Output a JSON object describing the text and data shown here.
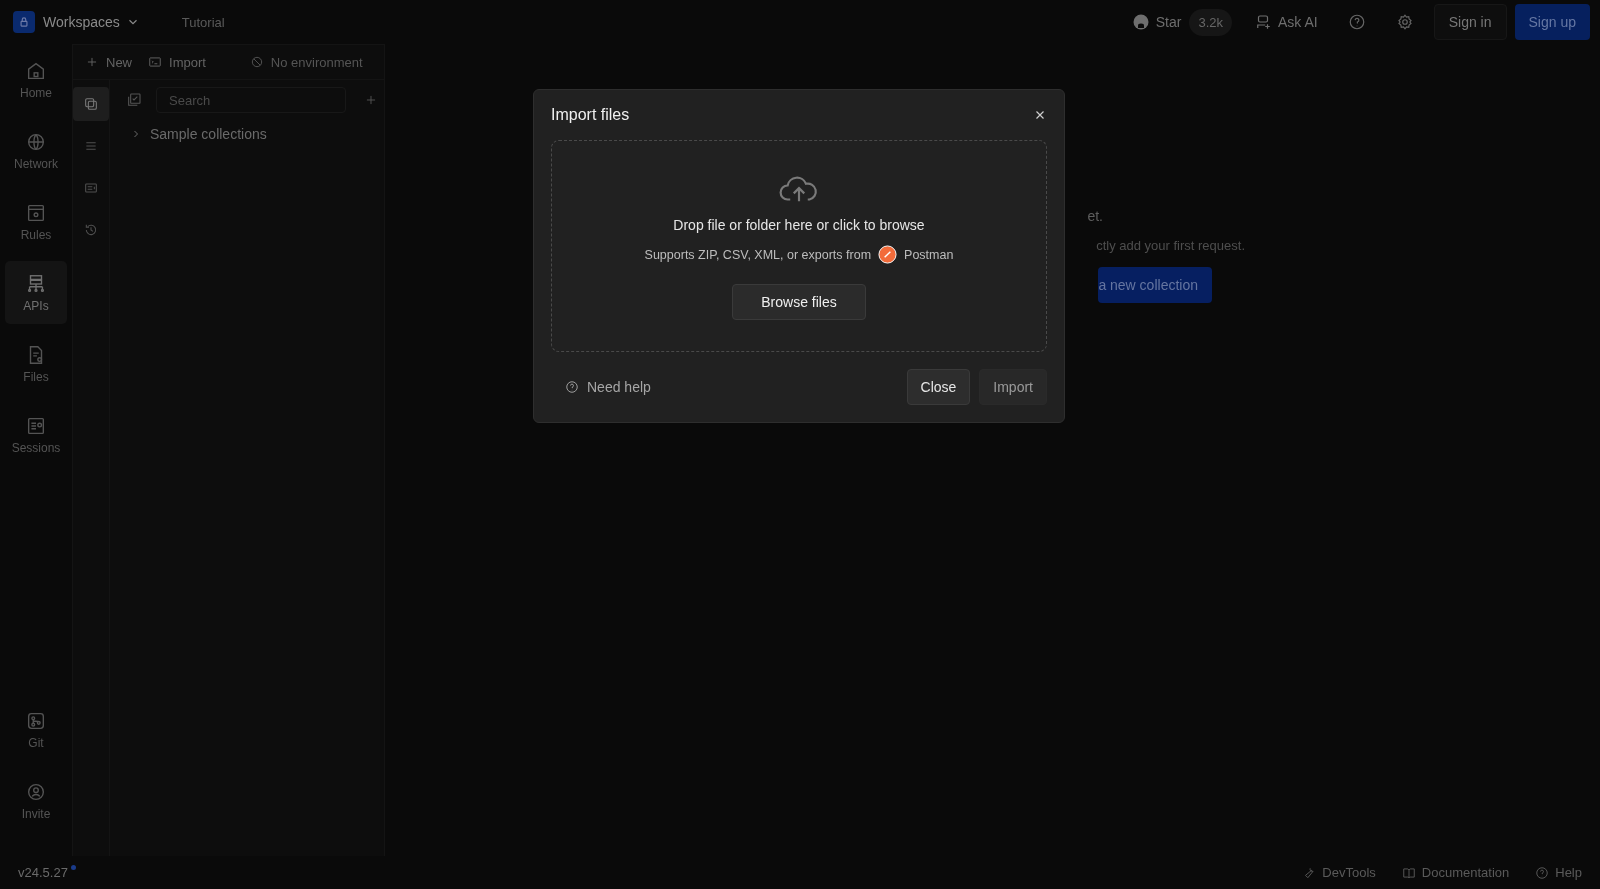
{
  "header": {
    "workspace": "Workspaces",
    "tutorial": "Tutorial",
    "star": "Star",
    "star_count": "3.2k",
    "ask_ai": "Ask AI",
    "sign_in": "Sign in",
    "sign_up": "Sign up"
  },
  "nav": {
    "items": [
      {
        "label": "Home",
        "kind": "home",
        "selected": false
      },
      {
        "label": "Network",
        "kind": "network",
        "selected": false
      },
      {
        "label": "Rules",
        "kind": "rules",
        "selected": false
      },
      {
        "label": "APIs",
        "kind": "apis",
        "selected": true
      },
      {
        "label": "Files",
        "kind": "files",
        "selected": false
      },
      {
        "label": "Sessions",
        "kind": "sessions",
        "selected": false
      }
    ],
    "bottom_items": [
      {
        "label": "Git",
        "kind": "git"
      },
      {
        "label": "Invite",
        "kind": "invite"
      }
    ]
  },
  "panel": {
    "new": "New",
    "import": "Import",
    "environment": "No environment",
    "tabs": [
      {
        "kind": "collections",
        "selected": true
      },
      {
        "kind": "list",
        "selected": false
      },
      {
        "kind": "environments",
        "selected": false
      },
      {
        "kind": "history",
        "selected": false
      }
    ],
    "search": {
      "placeholder": "Search"
    },
    "tree": [
      {
        "label": "Sample collections",
        "expanded": false
      }
    ]
  },
  "empty_state": {
    "title": "et.",
    "text": "ctly add your first request.",
    "button": "a new collection"
  },
  "dialog": {
    "title": "Import files",
    "drop_title": "Drop file or folder here or click to browse",
    "supports": "Supports ZIP, CSV, XML, or exports from",
    "source": "Postman",
    "browse": "Browse files",
    "help": "Need help",
    "close": "Close",
    "import": {
      "label": "Import",
      "disabled": true
    }
  },
  "status_bar": {
    "version": "v24.5.27",
    "links": [
      {
        "label": "DevTools",
        "kind": "devtools"
      },
      {
        "label": "Documentation",
        "kind": "docs"
      },
      {
        "label": "Help",
        "kind": "help"
      }
    ]
  }
}
